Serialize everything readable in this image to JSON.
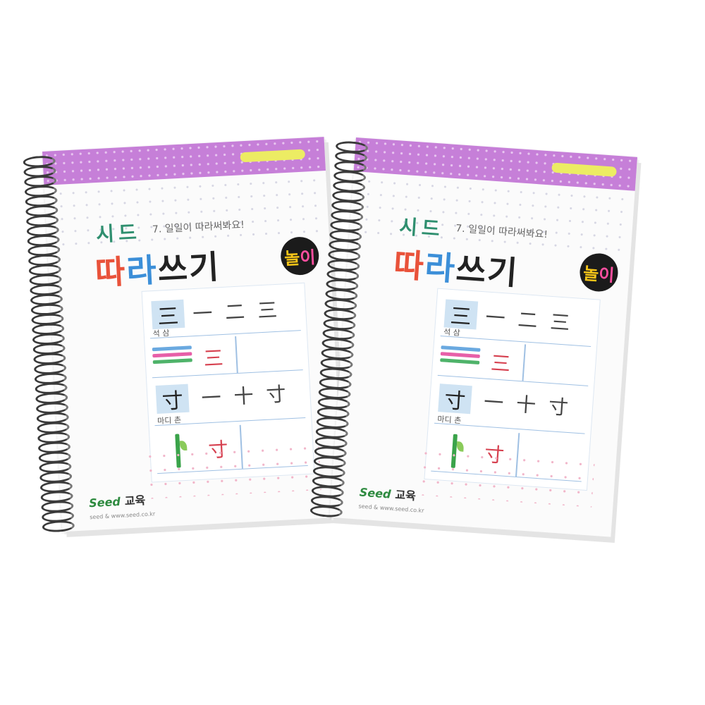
{
  "books": [
    {
      "brand": "시드",
      "subtitle": "7. 일일이 따라써봐요!",
      "title_part1": "따",
      "title_part2": "라",
      "title_part3": "쓰기",
      "badge_part1": "놀",
      "badge_part2": "이",
      "hanja_main_1": "三",
      "strokes_1": [
        "一",
        "二",
        "三"
      ],
      "meaning_1": "석 삼",
      "hanja_red_1": "三",
      "hanja_main_2": "寸",
      "strokes_2": [
        "一",
        "十",
        "寸"
      ],
      "meaning_2": "마디 촌",
      "hanja_red_2": "寸",
      "logo": "Seed",
      "logo_korean": "교육",
      "tagline": "seed & www.seed.co.kr"
    },
    {
      "brand": "시드",
      "subtitle": "7. 일일이 따라써봐요!",
      "title_part1": "따",
      "title_part2": "라",
      "title_part3": "쓰기",
      "badge_part1": "놀",
      "badge_part2": "이",
      "hanja_main_1": "三",
      "strokes_1": [
        "一",
        "二",
        "三"
      ],
      "meaning_1": "석 삼",
      "hanja_red_1": "三",
      "hanja_main_2": "寸",
      "strokes_2": [
        "一",
        "十",
        "寸"
      ],
      "meaning_2": "마디 촌",
      "hanja_red_2": "寸",
      "logo": "Seed",
      "logo_korean": "교육",
      "tagline": "seed & www.seed.co.kr"
    }
  ],
  "colors": {
    "band": "#c67fd8",
    "brand_green": "#2f8f6f",
    "hanja_red": "#d6404f",
    "grid_blue": "#9fc0e3",
    "spiral": "#3a3a3a"
  }
}
